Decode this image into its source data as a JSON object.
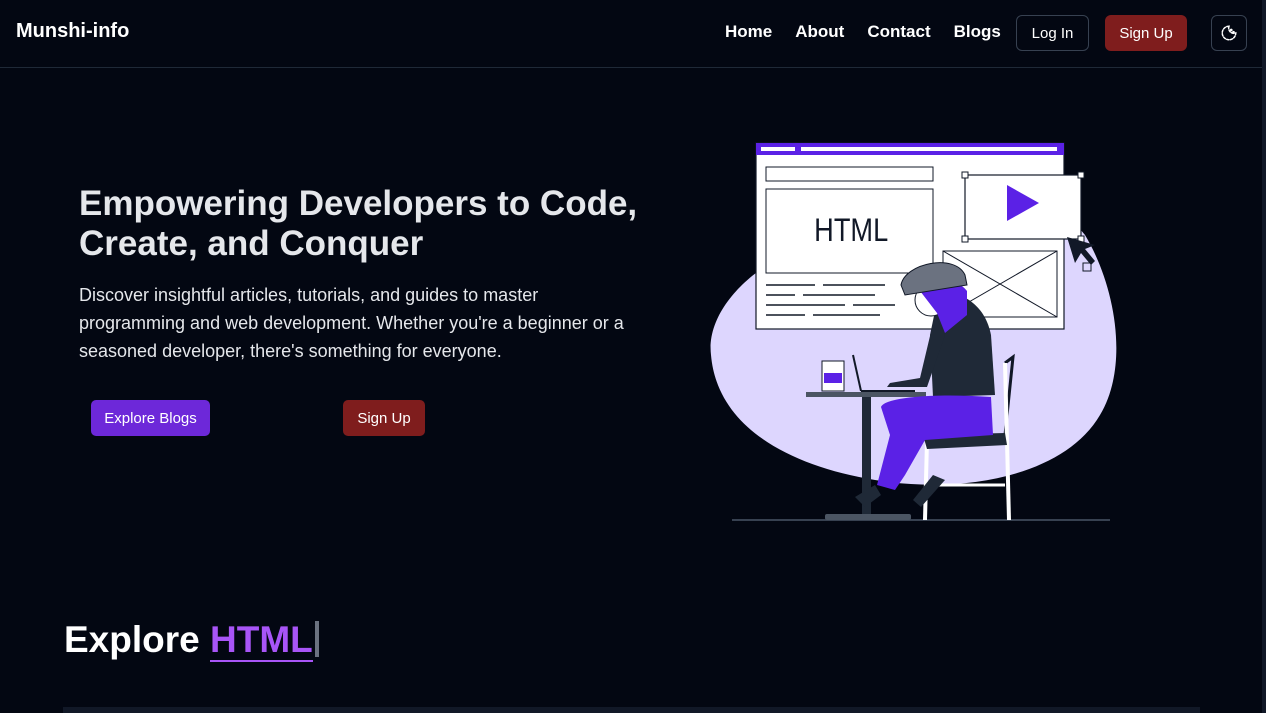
{
  "navbar": {
    "brand": "Munshi-info",
    "links": [
      "Home",
      "About",
      "Contact",
      "Blogs"
    ],
    "login_label": "Log In",
    "signup_label": "Sign Up",
    "theme_icon": "moon-icon"
  },
  "hero": {
    "title": "Empowering Developers to Code, Create, and Conquer",
    "subtitle": "Discover insightful articles, tutorials, and guides to master programming and web development. Whether you're a beginner or a seasoned developer, there's something for everyone.",
    "explore_label": "Explore Blogs",
    "signup_label": "Sign Up",
    "illustration": {
      "window_text": "HTML",
      "accent_color": "#5b21e6",
      "blob_color": "#ddd6fe"
    }
  },
  "explore": {
    "prefix": "Explore",
    "topic": "HTML"
  },
  "colors": {
    "background": "#030712",
    "primary": "#6d28d9",
    "danger": "#7f1d1d",
    "topic_accent": "#a855f7"
  }
}
